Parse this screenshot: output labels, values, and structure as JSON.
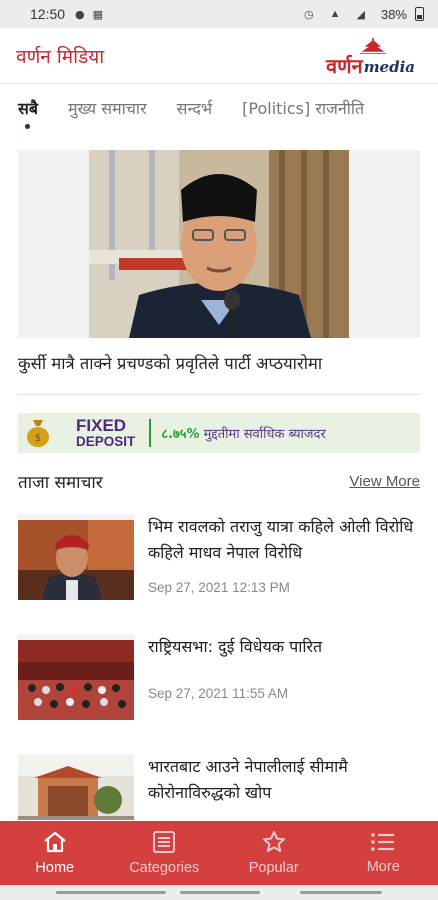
{
  "status_bar": {
    "time": "12:50",
    "battery": "38%"
  },
  "app_bar": {
    "title": "वर्णन मिडिया",
    "logo_text_np": "वर्णन",
    "logo_text_en": "media"
  },
  "tabs": [
    {
      "label": "सबै",
      "active": true
    },
    {
      "label": "मुख्य समाचार",
      "active": false
    },
    {
      "label": "सन्दर्भ",
      "active": false
    },
    {
      "label": "[Politics] राजनीति",
      "active": false
    }
  ],
  "featured": {
    "title": "कुर्सी मात्रै ताक्ने प्रचण्डको प्रवृतिले पार्टी अप्ठयारोमा"
  },
  "ad": {
    "line1": "FIXED",
    "line2": "DEPOSIT",
    "offer_rate": "८.७५%",
    "offer_text": "मुद्दतीमा सर्वाधिक ब्याजदर"
  },
  "latest": {
    "heading": "ताजा समाचार",
    "view_more": "View More",
    "items": [
      {
        "title": "भिम रावलको तराजु यात्रा कहिले ओली विरोधि कहिले माधव नेपाल विरोधि",
        "date": "Sep 27, 2021 12:13 PM"
      },
      {
        "title": "राष्ट्रियसभा: दुई विधेयक पारित",
        "date": "Sep 27, 2021 11:55 AM"
      },
      {
        "title": "भारतबाट आउने नेपालीलाई सीमामै कोरोनाविरुद्धको खोप",
        "date": ""
      }
    ]
  },
  "bottom_nav": [
    {
      "label": "Home",
      "icon": "home-icon",
      "active": true
    },
    {
      "label": "Categories",
      "icon": "list-icon",
      "active": false
    },
    {
      "label": "Popular",
      "icon": "star-icon",
      "active": false
    },
    {
      "label": "More",
      "icon": "menu-icon",
      "active": false
    }
  ],
  "colors": {
    "brand_red": "#c8272e",
    "nav_bg": "#d3403f",
    "logo_blue": "#1f2f6b"
  }
}
